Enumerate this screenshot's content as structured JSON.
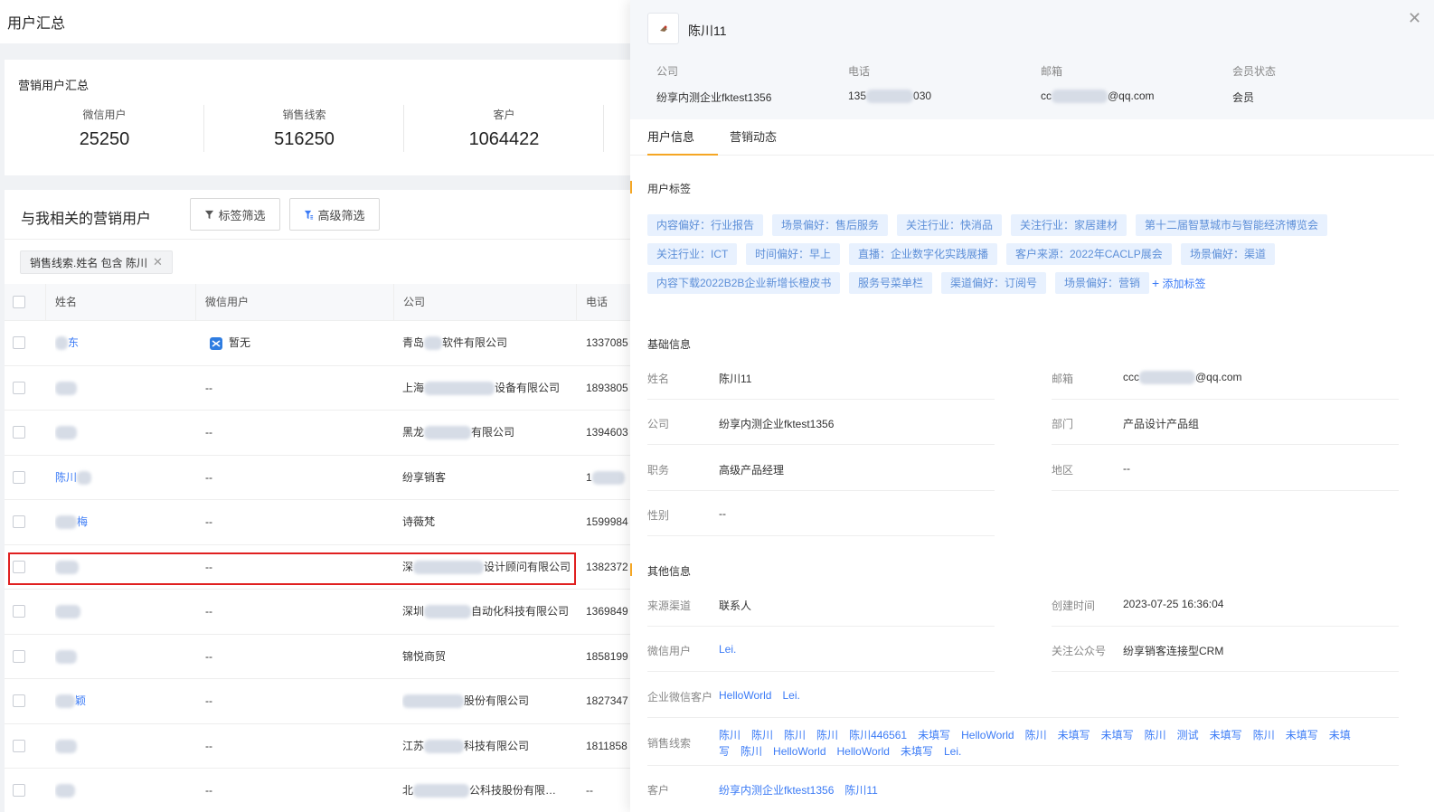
{
  "page": {
    "title": "用户汇总"
  },
  "summary": {
    "title": "营销用户汇总",
    "stats": [
      {
        "label": "微信用户",
        "value": "25250"
      },
      {
        "label": "销售线索",
        "value": "516250"
      },
      {
        "label": "客户",
        "value": "1064422"
      }
    ]
  },
  "users": {
    "title": "与我相关的营销用户",
    "tag_filter_label": "标签筛选",
    "advanced_filter_label": "高级筛选",
    "active_filter": "销售线索.姓名 包含 陈川",
    "columns": [
      "姓名",
      "微信用户",
      "公司",
      "电话"
    ],
    "rows": [
      {
        "name_head": "",
        "name_tail": "东",
        "wechat": "暂无",
        "company_head": "青岛",
        "company_tail": "软件有限公司",
        "phone": "1337085"
      },
      {
        "name_head": "",
        "name_tail": "",
        "wechat": "--",
        "company_head": "上海",
        "company_tail": "设备有限公司",
        "phone": "1893805"
      },
      {
        "name_head": "",
        "name_tail": "",
        "wechat": "--",
        "company_head": "黑龙",
        "company_tail": "有限公司",
        "phone": "1394603"
      },
      {
        "name_head": "陈川",
        "name_tail": "",
        "wechat": "--",
        "company_head": "纷享销客",
        "company_tail": "",
        "phone": "1"
      },
      {
        "name_head": "",
        "name_tail": "梅",
        "wechat": "--",
        "company_head": "诗薇梵",
        "company_tail": "",
        "phone": "1599984"
      },
      {
        "name_head": "",
        "name_tail": "",
        "wechat": "--",
        "company_head": "深",
        "company_tail": "设计顾问有限公司",
        "phone": "1382372"
      },
      {
        "name_head": "",
        "name_tail": "",
        "wechat": "--",
        "company_head": "深圳",
        "company_tail": "自动化科技有限公司",
        "phone": "1369849"
      },
      {
        "name_head": "",
        "name_tail": "",
        "wechat": "--",
        "company_head": "锦悦商贸",
        "company_tail": "",
        "phone": "1858199"
      },
      {
        "name_head": "",
        "name_tail": "颖",
        "wechat": "--",
        "company_head": "",
        "company_tail": "股份有限公司",
        "phone": "1827347"
      },
      {
        "name_head": "",
        "name_tail": "",
        "wechat": "--",
        "company_head": "江苏",
        "company_tail": "科技有限公司",
        "phone": "1811858"
      },
      {
        "name_head": "",
        "name_tail": "",
        "wechat": "--",
        "company_head": "北",
        "company_tail": "公科技股份有限…",
        "phone": "--"
      }
    ]
  },
  "drawer": {
    "name": "陈川11",
    "meta": [
      {
        "label": "公司",
        "value": "纷享内测企业fktest1356"
      },
      {
        "label": "电话",
        "value": "135",
        "value_tail": "030"
      },
      {
        "label": "邮箱",
        "value": "cc",
        "value_tail": "@qq.com"
      },
      {
        "label": "会员状态",
        "value": "会员"
      }
    ],
    "tabs": [
      "用户信息",
      "营销动态"
    ],
    "tags_title": "用户标签",
    "tags": [
      "内容偏好：行业报告",
      "场景偏好：售后服务",
      "关注行业：快消品",
      "关注行业：家居建材",
      "第十二届智慧城市与智能经济博览会",
      "关注行业：ICT",
      "时间偏好：早上",
      "直播：企业数字化实践展播",
      "客户来源：2022年CACLP展会",
      "场景偏好：渠道",
      "内容下载2022B2B企业新增长橙皮书",
      "服务号菜单栏",
      "渠道偏好：订阅号",
      "场景偏好：营销"
    ],
    "add_tag": "添加标签",
    "basic_title": "基础信息",
    "basic": {
      "name_label": "姓名",
      "name": "陈川11",
      "email_label": "邮箱",
      "email_head": "ccc",
      "email_tail": "@qq.com",
      "company_label": "公司",
      "company": "纷享内测企业fktest1356",
      "dept_label": "部门",
      "dept": "产品设计产品组",
      "title_label": "职务",
      "title": "高级产品经理",
      "region_label": "地区",
      "region": "--",
      "gender_label": "性别",
      "gender": "--"
    },
    "other_title": "其他信息",
    "other": {
      "source_label": "来源渠道",
      "source": "联系人",
      "created_label": "创建时间",
      "created": "2023-07-25 16:36:04",
      "wechat_label": "微信用户",
      "wechat": "Lei.",
      "official_label": "关注公众号",
      "official": "纷享销客连接型CRM",
      "wecom_label": "企业微信客户",
      "wecom": [
        "HelloWorld",
        "Lei."
      ],
      "leads_label": "销售线索",
      "leads_line1": [
        "陈川",
        "陈川",
        "陈川",
        "陈川",
        "陈川446561",
        "未填写",
        "HelloWorld",
        "陈川",
        "未填写",
        "未填写",
        "陈川",
        "测试",
        "未填写",
        "陈川",
        "未填写",
        "未填"
      ],
      "leads_line2": [
        "写",
        "陈川",
        "HelloWorld",
        "HelloWorld",
        "未填写",
        "Lei."
      ],
      "customer_label": "客户",
      "customers": [
        "纷享内测企业fktest1356",
        "陈川11"
      ]
    }
  },
  "colors": {
    "accent": "#f5a623",
    "link": "#3b7bf6",
    "tag_bg": "#e8f1fe",
    "tag_text": "#5d8fd8",
    "highlight": "#e02020"
  }
}
